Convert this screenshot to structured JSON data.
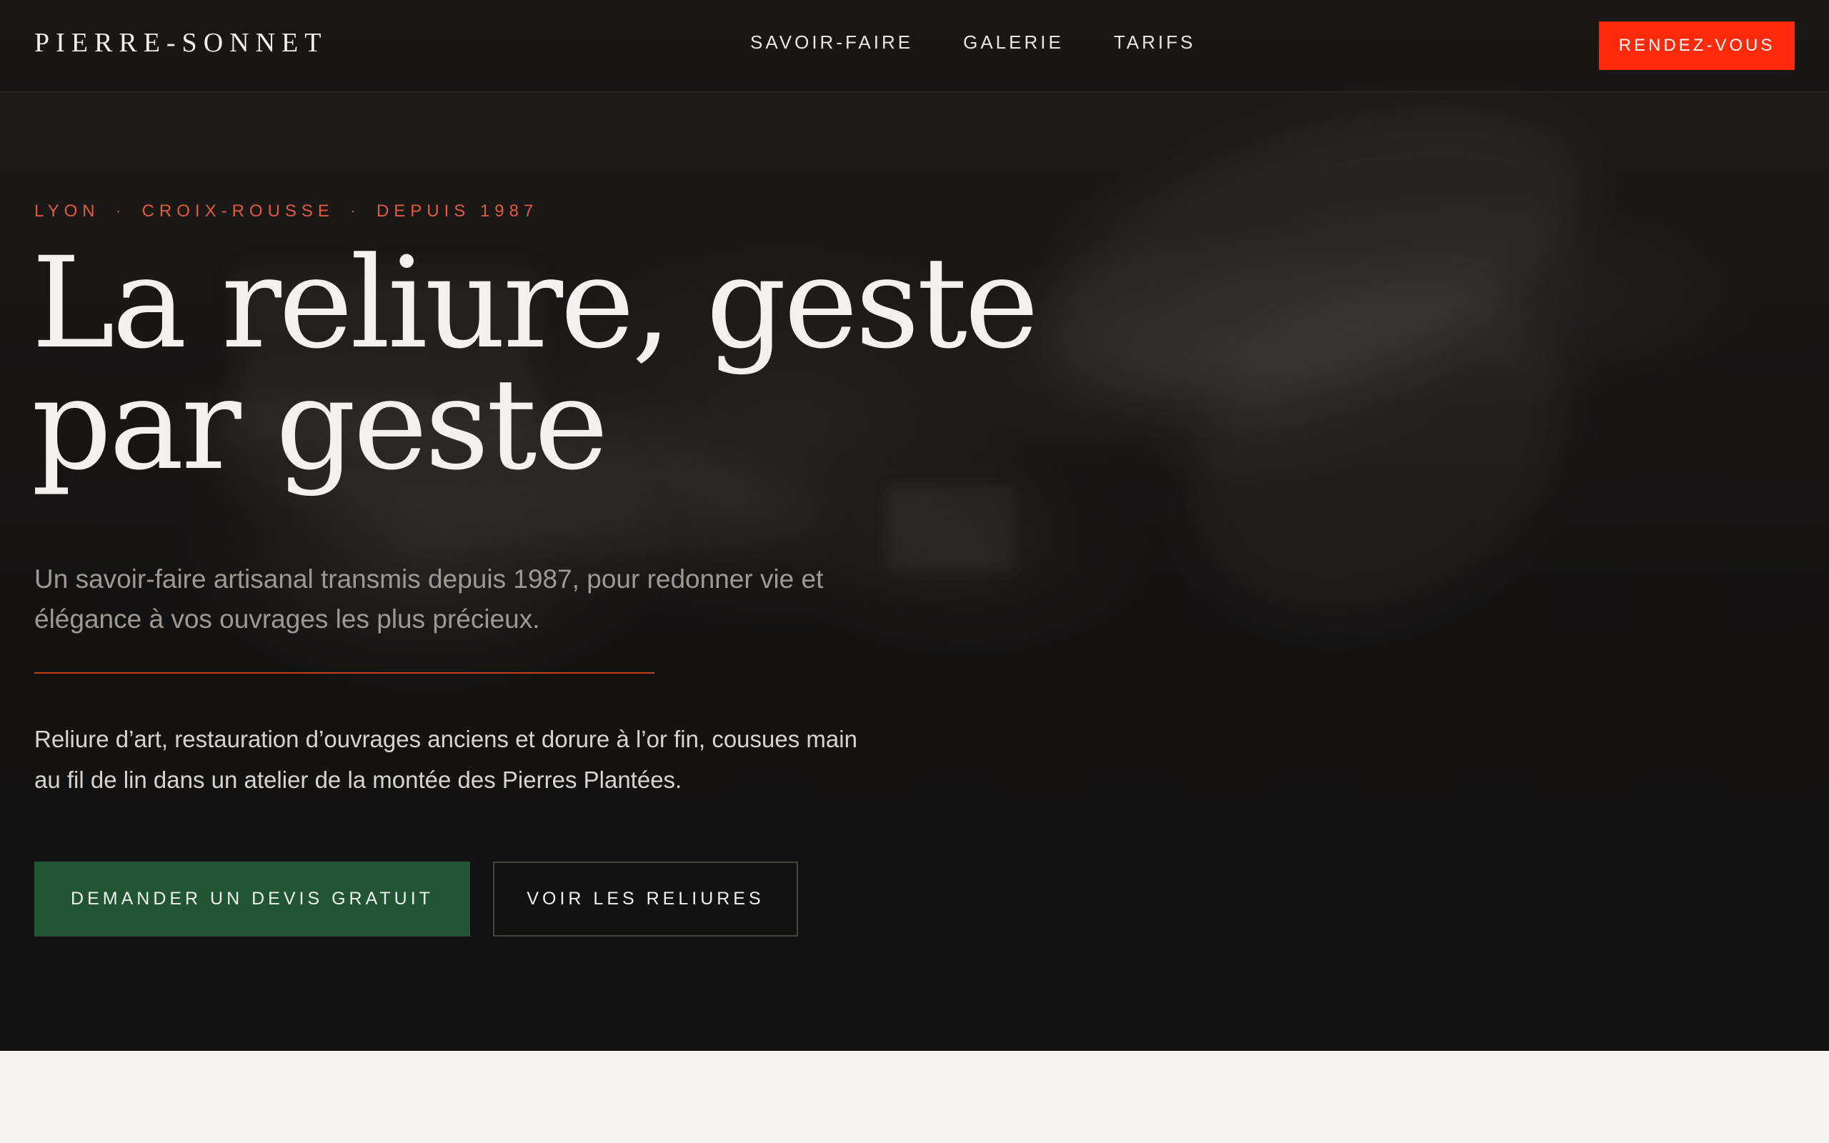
{
  "brand": {
    "name": "PIERRE-SONNET"
  },
  "nav": {
    "items": [
      {
        "label": "SAVOIR-FAIRE"
      },
      {
        "label": "GALERIE"
      },
      {
        "label": "TARIFS"
      }
    ],
    "cta_label": "RENDEZ-VOUS"
  },
  "hero": {
    "eyebrow": {
      "parts": [
        "LYON",
        "CROIX-ROUSSE",
        "DEPUIS 1987"
      ],
      "separator": "·"
    },
    "title": "La reliure, geste par geste",
    "lede": "Un savoir-faire artisanal transmis depuis 1987, pour redonner vie et élégance à vos ouvrages les plus précieux.",
    "body": "Reliure d’art, restauration d’ouvrages anciens et dorure à l’or fin, cousues main au fil de lin dans un atelier de la montée des Pierres Plantées.",
    "primary_button": "DEMANDER UN DEVIS GRATUIT",
    "secondary_button": "VOIR LES RELIURES"
  },
  "colors": {
    "accent": "#ff2a0c",
    "eyebrow": "#e25a3c",
    "primary_button": "#225533",
    "hero_background": "#121212",
    "page_background": "#f5f4f1"
  }
}
